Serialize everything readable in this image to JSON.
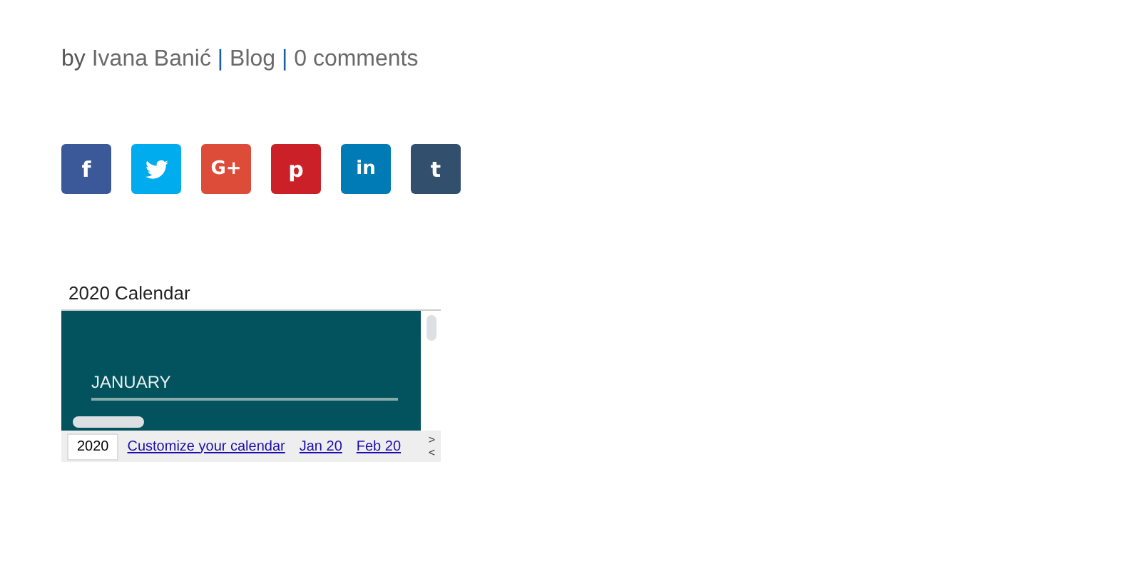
{
  "byline": {
    "prefix": "by",
    "author": "Ivana Banić",
    "category": "Blog",
    "comments": "0 comments",
    "separator": "|"
  },
  "share_buttons": [
    {
      "kind": "facebook",
      "glyph": "f",
      "color": "#3b5998"
    },
    {
      "kind": "twitter",
      "color": "#00aced"
    },
    {
      "kind": "googleplus",
      "glyph": "G+",
      "color": "#dd4b39"
    },
    {
      "kind": "pinterest",
      "glyph": "p",
      "color": "#cb2027"
    },
    {
      "kind": "linkedin",
      "glyph": "in",
      "color": "#007bb6"
    },
    {
      "kind": "tumblr",
      "glyph": "t",
      "color": "#32506d"
    }
  ],
  "calendar": {
    "title": "2020 Calendar",
    "month": "JANUARY",
    "tabs": [
      {
        "label": "2020",
        "selected": true
      }
    ],
    "links": [
      "Customize your calendar",
      "Jan 20",
      "Feb 20"
    ],
    "scroll_up": "˃",
    "scroll_down": "˂"
  }
}
